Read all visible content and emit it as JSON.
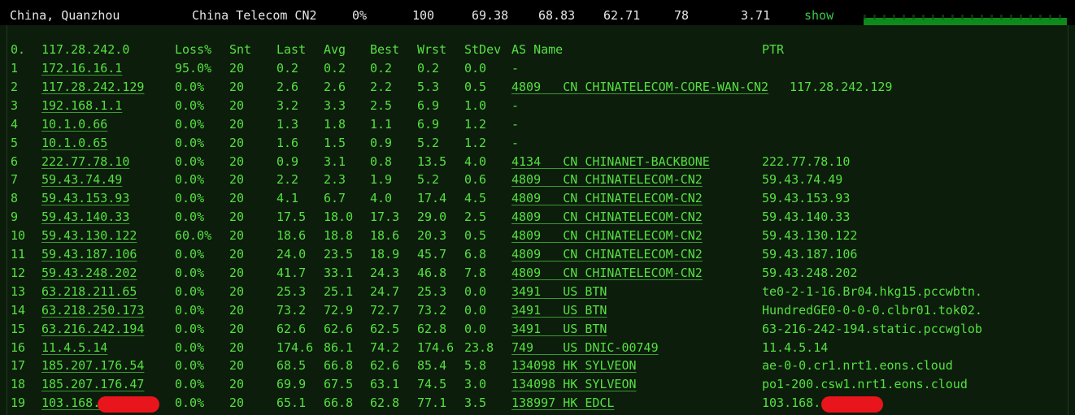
{
  "summary": {
    "location": "China, Quanzhou",
    "isp": "China Telecom CN2",
    "loss": "0%",
    "sent": "100",
    "last": "69.38",
    "avg": "68.83",
    "best": "62.71",
    "wrst": "78",
    "stdev": "3.71",
    "action": "show"
  },
  "table": {
    "headers": {
      "idx": "0.",
      "host": "117.28.242.0",
      "loss": "Loss%",
      "snt": "Snt",
      "last": "Last",
      "avg": "Avg",
      "best": "Best",
      "wrst": "Wrst",
      "stdev": "StDev",
      "asname": "AS Name",
      "ptr": "PTR"
    },
    "rows": [
      {
        "idx": "1",
        "host": "172.16.16.1",
        "loss": "95.0%",
        "snt": "20",
        "last": "0.2",
        "avg": "0.2",
        "best": "0.2",
        "wrst": "0.2",
        "stdev": "0.0",
        "asn": "",
        "cc": "",
        "asname": "-",
        "ptr": ""
      },
      {
        "idx": "2",
        "host": "117.28.242.129",
        "loss": "0.0%",
        "snt": "20",
        "last": "2.6",
        "avg": "2.6",
        "best": "2.2",
        "wrst": "5.3",
        "stdev": "0.5",
        "asn": "4809",
        "cc": "CN",
        "asname": "CHINATELECOM-CORE-WAN-CN2",
        "ptr": "117.28.242.129"
      },
      {
        "idx": "3",
        "host": "192.168.1.1",
        "loss": "0.0%",
        "snt": "20",
        "last": "3.2",
        "avg": "3.3",
        "best": "2.5",
        "wrst": "6.9",
        "stdev": "1.0",
        "asn": "",
        "cc": "",
        "asname": "-",
        "ptr": ""
      },
      {
        "idx": "4",
        "host": "10.1.0.66",
        "loss": "0.0%",
        "snt": "20",
        "last": "1.3",
        "avg": "1.8",
        "best": "1.1",
        "wrst": "6.9",
        "stdev": "1.2",
        "asn": "",
        "cc": "",
        "asname": "-",
        "ptr": ""
      },
      {
        "idx": "5",
        "host": "10.1.0.65",
        "loss": "0.0%",
        "snt": "20",
        "last": "1.6",
        "avg": "1.5",
        "best": "0.9",
        "wrst": "5.2",
        "stdev": "1.2",
        "asn": "",
        "cc": "",
        "asname": "-",
        "ptr": ""
      },
      {
        "idx": "6",
        "host": "222.77.78.10",
        "loss": "0.0%",
        "snt": "20",
        "last": "0.9",
        "avg": "3.1",
        "best": "0.8",
        "wrst": "13.5",
        "stdev": "4.0",
        "asn": "4134",
        "cc": "CN",
        "asname": "CHINANET-BACKBONE",
        "ptr": "222.77.78.10"
      },
      {
        "idx": "7",
        "host": "59.43.74.49",
        "loss": "0.0%",
        "snt": "20",
        "last": "2.2",
        "avg": "2.3",
        "best": "1.9",
        "wrst": "5.2",
        "stdev": "0.6",
        "asn": "4809",
        "cc": "CN",
        "asname": "CHINATELECOM-CN2",
        "ptr": "59.43.74.49"
      },
      {
        "idx": "8",
        "host": "59.43.153.93",
        "loss": "0.0%",
        "snt": "20",
        "last": "4.1",
        "avg": "6.7",
        "best": "4.0",
        "wrst": "17.4",
        "stdev": "4.5",
        "asn": "4809",
        "cc": "CN",
        "asname": "CHINATELECOM-CN2",
        "ptr": "59.43.153.93"
      },
      {
        "idx": "9",
        "host": "59.43.140.33",
        "loss": "0.0%",
        "snt": "20",
        "last": "17.5",
        "avg": "18.0",
        "best": "17.3",
        "wrst": "29.0",
        "stdev": "2.5",
        "asn": "4809",
        "cc": "CN",
        "asname": "CHINATELECOM-CN2",
        "ptr": "59.43.140.33"
      },
      {
        "idx": "10",
        "host": "59.43.130.122",
        "loss": "60.0%",
        "snt": "20",
        "last": "18.6",
        "avg": "18.8",
        "best": "18.6",
        "wrst": "20.3",
        "stdev": "0.5",
        "asn": "4809",
        "cc": "CN",
        "asname": "CHINATELECOM-CN2",
        "ptr": "59.43.130.122"
      },
      {
        "idx": "11",
        "host": "59.43.187.106",
        "loss": "0.0%",
        "snt": "20",
        "last": "24.0",
        "avg": "23.5",
        "best": "18.9",
        "wrst": "45.7",
        "stdev": "6.8",
        "asn": "4809",
        "cc": "CN",
        "asname": "CHINATELECOM-CN2",
        "ptr": "59.43.187.106"
      },
      {
        "idx": "12",
        "host": "59.43.248.202",
        "loss": "0.0%",
        "snt": "20",
        "last": "41.7",
        "avg": "33.1",
        "best": "24.3",
        "wrst": "46.8",
        "stdev": "7.8",
        "asn": "4809",
        "cc": "CN",
        "asname": "CHINATELECOM-CN2",
        "ptr": "59.43.248.202"
      },
      {
        "idx": "13",
        "host": "63.218.211.65",
        "loss": "0.0%",
        "snt": "20",
        "last": "25.3",
        "avg": "25.1",
        "best": "24.7",
        "wrst": "25.3",
        "stdev": "0.0",
        "asn": "3491",
        "cc": "US",
        "asname": "BTN",
        "ptr": "te0-2-1-16.Br04.hkg15.pccwbtn."
      },
      {
        "idx": "14",
        "host": "63.218.250.173",
        "loss": "0.0%",
        "snt": "20",
        "last": "73.2",
        "avg": "72.9",
        "best": "72.7",
        "wrst": "73.2",
        "stdev": "0.0",
        "asn": "3491",
        "cc": "US",
        "asname": "BTN",
        "ptr": "HundredGE0-0-0-0.clbr01.tok02."
      },
      {
        "idx": "15",
        "host": "63.216.242.194",
        "loss": "0.0%",
        "snt": "20",
        "last": "62.6",
        "avg": "62.6",
        "best": "62.5",
        "wrst": "62.8",
        "stdev": "0.0",
        "asn": "3491",
        "cc": "US",
        "asname": "BTN",
        "ptr": "63-216-242-194.static.pccwglob"
      },
      {
        "idx": "16",
        "host": "11.4.5.14",
        "loss": "0.0%",
        "snt": "20",
        "last": "174.6",
        "avg": "86.1",
        "best": "74.2",
        "wrst": "174.6",
        "stdev": "23.8",
        "asn": "749",
        "cc": "US",
        "asname": "DNIC-00749",
        "ptr": "11.4.5.14"
      },
      {
        "idx": "17",
        "host": "185.207.176.54",
        "loss": "0.0%",
        "snt": "20",
        "last": "68.5",
        "avg": "66.8",
        "best": "62.6",
        "wrst": "85.4",
        "stdev": "5.8",
        "asn": "134098",
        "cc": "HK",
        "asname": "SYLVEON",
        "ptr": "ae-0-0.cr1.nrt1.eons.cloud"
      },
      {
        "idx": "18",
        "host": "185.207.176.47",
        "loss": "0.0%",
        "snt": "20",
        "last": "69.9",
        "avg": "67.5",
        "best": "63.1",
        "wrst": "74.5",
        "stdev": "3.0",
        "asn": "134098",
        "cc": "HK",
        "asname": "SYLVEON",
        "ptr": "po1-200.csw1.nrt1.eons.cloud"
      },
      {
        "idx": "19",
        "host": "103.168.",
        "loss": "0.0%",
        "snt": "20",
        "last": "65.1",
        "avg": "66.8",
        "best": "62.8",
        "wrst": "77.1",
        "stdev": "3.5",
        "asn": "138997",
        "cc": "HK",
        "asname": "EDCL",
        "ptr": "103.168."
      }
    ]
  },
  "colors": {
    "background": "#0c1d0c",
    "text_green": "#55e040",
    "header_text": "#e6e6e6",
    "redaction": "#e8151c"
  }
}
